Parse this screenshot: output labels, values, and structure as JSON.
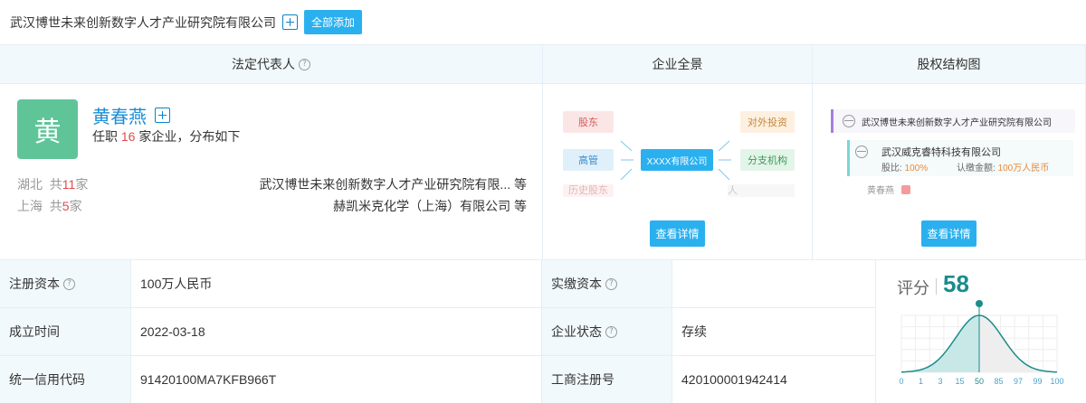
{
  "header": {
    "company_name": "武汉博世未来创新数字人才产业研究院有限公司",
    "add_all_label": "全部添加"
  },
  "columns": {
    "legal_rep": "法定代表人",
    "overview": "企业全景",
    "equity": "股权结构图"
  },
  "legal_rep": {
    "avatar_char": "黄",
    "name": "黄春燕",
    "summary_prefix": "任职 ",
    "summary_count": "16",
    "summary_suffix": " 家企业，分布如下",
    "regions": [
      {
        "region": "湖北",
        "prefix": "共",
        "count": "11",
        "suffix": "家",
        "company": "武汉博世未来创新数字人才产业研究院有限... 等"
      },
      {
        "region": "上海",
        "prefix": "共",
        "count": "5",
        "suffix": "家",
        "company": "赫凯米克化学（上海）有限公司 等"
      }
    ]
  },
  "overview": {
    "left_items": [
      "股东",
      "高管",
      "历史股东"
    ],
    "center": "XXXX有限公司",
    "right_items": [
      "对外投资",
      "分支机构",
      "历史法定代表人"
    ],
    "detail_btn": "查看详情"
  },
  "equity": {
    "root": "武汉博世未来创新数字人才产业研究院有限公司",
    "child": "武汉威克睿特科技有限公司",
    "ratio_label": "股比:",
    "ratio": "100%",
    "capital_label": "认缴金额:",
    "capital": "100万人民币",
    "person": "黄春燕",
    "detail_btn": "查看详情"
  },
  "info": {
    "reg_capital_label": "注册资本",
    "reg_capital": "100万人民币",
    "paid_capital_label": "实缴资本",
    "paid_capital": "",
    "founded_label": "成立时间",
    "founded": "2022-03-18",
    "status_label": "企业状态",
    "status": "存续",
    "credit_code_label": "统一信用代码",
    "credit_code": "91420100MA7KFB966T",
    "reg_no_label": "工商注册号",
    "reg_no": "420100001942414"
  },
  "score": {
    "label": "评分",
    "value": 58,
    "value_text": "58",
    "axis_ticks": [
      "0",
      "1",
      "3",
      "15",
      "50",
      "85",
      "97",
      "99",
      "100"
    ],
    "highlight_tick": "50",
    "accent": "#1a8c8c"
  },
  "colors": {
    "button": "#2bb0ef",
    "link": "#1a8ed6",
    "avatar": "#5fc598",
    "highlight_num": "#e24a4a"
  }
}
